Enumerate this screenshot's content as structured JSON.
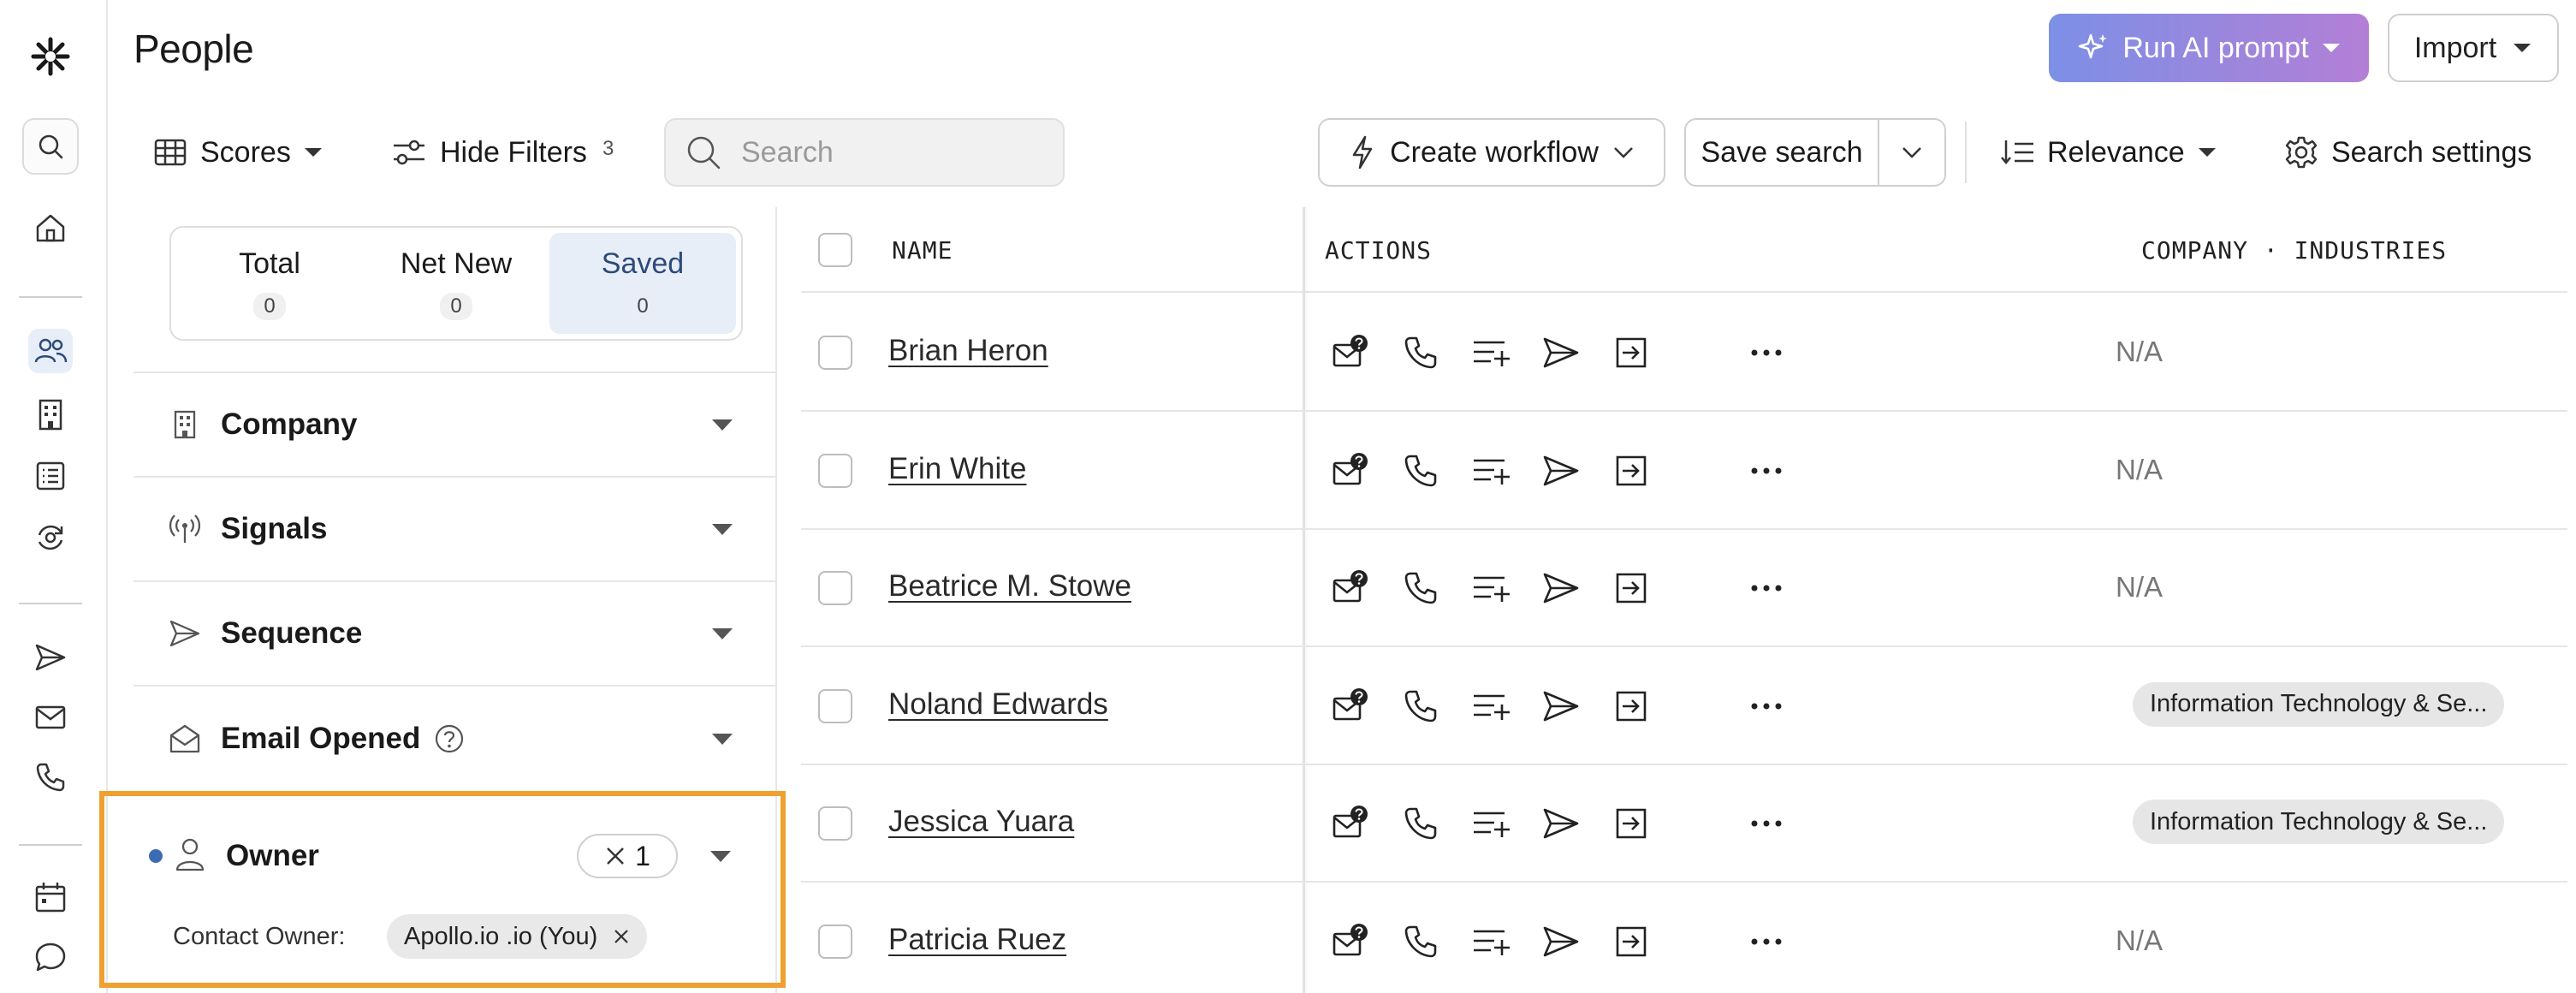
{
  "app": {
    "page_title": "People",
    "ai_button_label": "Run AI prompt",
    "import_button_label": "Import"
  },
  "toolbar": {
    "scores_label": "Scores",
    "hide_filters_label": "Hide Filters",
    "filters_count": "3",
    "search_placeholder": "Search",
    "create_workflow_label": "Create workflow",
    "save_search_label": "Save search",
    "sort_label": "Relevance",
    "search_settings_label": "Search settings"
  },
  "rail": {
    "icons": [
      "logo-icon",
      "search-icon",
      "home-icon",
      "people-icon",
      "building-icon",
      "list-icon",
      "refresh-icon",
      "send-icon",
      "mail-icon",
      "phone-icon",
      "calendar-icon",
      "chat-icon"
    ],
    "active": "people-icon"
  },
  "segments": [
    {
      "label": "Total",
      "count": "0"
    },
    {
      "label": "Net New",
      "count": "0"
    },
    {
      "label": "Saved",
      "count": "0",
      "active": true
    }
  ],
  "filters": [
    {
      "label": "Company",
      "icon": "building-icon"
    },
    {
      "label": "Signals",
      "icon": "signal-icon"
    },
    {
      "label": "Sequence",
      "icon": "send-icon"
    },
    {
      "label": "Email Opened",
      "icon": "mail-open-icon",
      "help": true
    }
  ],
  "owner_filter": {
    "label": "Owner",
    "chip_count": "1",
    "contact_owner_label": "Contact Owner:",
    "contact_owner_value": "Apollo.io .io (You)",
    "highlight_color": "#f0a030"
  },
  "table": {
    "headers": {
      "name": "NAME",
      "actions": "ACTIONS",
      "company_industries": "COMPANY · INDUSTRIES"
    },
    "rows": [
      {
        "name": "Brian Heron",
        "industry": "N/A",
        "industry_is_pill": false
      },
      {
        "name": "Erin White",
        "industry": "N/A",
        "industry_is_pill": false
      },
      {
        "name": "Beatrice M. Stowe",
        "industry": "N/A",
        "industry_is_pill": false
      },
      {
        "name": "Noland Edwards",
        "industry": "Information Technology & Se...",
        "industry_is_pill": true
      },
      {
        "name": "Jessica Yuara",
        "industry": "Information Technology & Se...",
        "industry_is_pill": true
      },
      {
        "name": "Patricia Ruez",
        "industry": "N/A",
        "industry_is_pill": false
      }
    ]
  },
  "colors": {
    "accent_blue": "#3d6bb3",
    "ai_gradient_start": "#7d8fe6",
    "ai_gradient_end": "#b37fd6",
    "active_bg": "#e8eef8"
  }
}
